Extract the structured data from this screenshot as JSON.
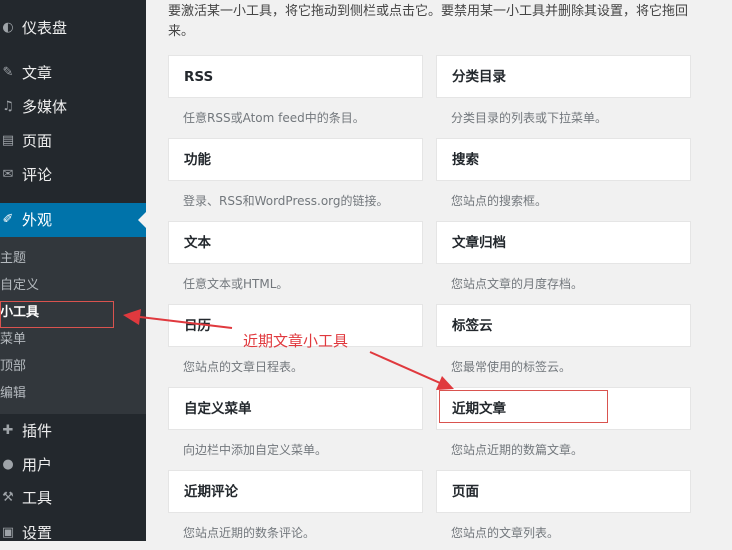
{
  "sidebar": {
    "items": [
      {
        "label": "仪表盘",
        "icon": "dashboard-icon",
        "glyph": "◐"
      },
      {
        "label": "文章",
        "icon": "pushpin-icon",
        "glyph": "✎"
      },
      {
        "label": "多媒体",
        "icon": "media-icon",
        "glyph": "♫"
      },
      {
        "label": "页面",
        "icon": "page-icon",
        "glyph": "▤"
      },
      {
        "label": "评论",
        "icon": "comment-icon",
        "glyph": "✉"
      },
      {
        "label": "外观",
        "icon": "appearance-icon",
        "glyph": "✐"
      },
      {
        "label": "插件",
        "icon": "plugin-icon",
        "glyph": "✚"
      },
      {
        "label": "用户",
        "icon": "user-icon",
        "glyph": "●"
      },
      {
        "label": "工具",
        "icon": "wrench-icon",
        "glyph": "⚒"
      },
      {
        "label": "设置",
        "icon": "settings-icon",
        "glyph": "▣"
      }
    ],
    "submenu": [
      "主题",
      "自定义",
      "小工具",
      "菜单",
      "顶部",
      "编辑"
    ]
  },
  "intro": "要激活某一小工具，将它拖动到侧栏或点击它。要禁用某一小工具并删除其设置，将它拖回来。",
  "widgets": [
    {
      "title": "RSS",
      "desc": "任意RSS或Atom feed中的条目。"
    },
    {
      "title": "分类目录",
      "desc": "分类目录的列表或下拉菜单。"
    },
    {
      "title": "功能",
      "desc": "登录、RSS和WordPress.org的链接。"
    },
    {
      "title": "搜索",
      "desc": "您站点的搜索框。"
    },
    {
      "title": "文本",
      "desc": "任意文本或HTML。"
    },
    {
      "title": "文章归档",
      "desc": "您站点文章的月度存档。"
    },
    {
      "title": "日历",
      "desc": "您站点的文章日程表。"
    },
    {
      "title": "标签云",
      "desc": "您最常使用的标签云。"
    },
    {
      "title": "自定义菜单",
      "desc": "向边栏中添加自定义菜单。"
    },
    {
      "title": "近期文章",
      "desc": "您站点近期的数篇文章。"
    },
    {
      "title": "近期评论",
      "desc": "您站点近期的数条评论。"
    },
    {
      "title": "页面",
      "desc": "您站点的文章列表。"
    }
  ],
  "annotation": {
    "label": "近期文章小工具",
    "color": "#e0393e"
  }
}
